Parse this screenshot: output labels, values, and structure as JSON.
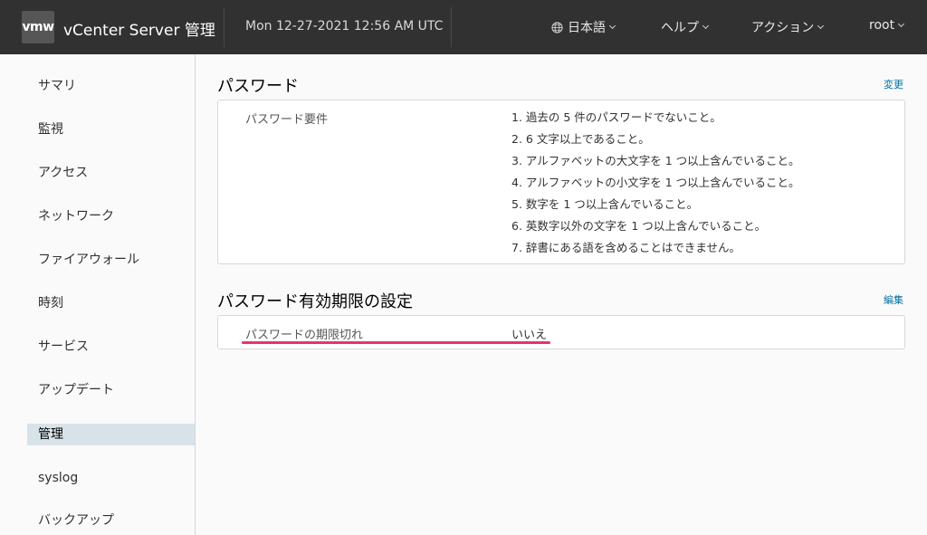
{
  "header": {
    "logo": "vmw",
    "title": "vCenter Server 管理",
    "datetime": "Mon 12-27-2021 12:56 AM UTC",
    "language": "日本語",
    "help": "ヘルプ",
    "actions": "アクション",
    "user": "root"
  },
  "sidebar": {
    "items": [
      {
        "label": "サマリ"
      },
      {
        "label": "監視"
      },
      {
        "label": "アクセス"
      },
      {
        "label": "ネットワーク"
      },
      {
        "label": "ファイアウォール"
      },
      {
        "label": "時刻"
      },
      {
        "label": "サービス"
      },
      {
        "label": "アップデート"
      },
      {
        "label": "管理"
      },
      {
        "label": "syslog"
      },
      {
        "label": "バックアップ"
      }
    ],
    "active": "管理"
  },
  "password": {
    "title": "パスワード",
    "action": "変更",
    "label": "パスワード要件",
    "requirements": [
      "1. 過去の 5 件のパスワードでないこと。",
      "2. 6 文字以上であること。",
      "3. アルファベットの大文字を 1 つ以上含んでいること。",
      "4. アルファベットの小文字を 1 つ以上含んでいること。",
      "5. 数字を 1 つ以上含んでいること。",
      "6. 英数字以外の文字を 1 つ以上含んでいること。",
      "7. 辞書にある語を含めることはできません。"
    ]
  },
  "expiration": {
    "title": "パスワード有効期限の設定",
    "action": "編集",
    "label": "パスワードの期限切れ",
    "value": "いいえ"
  },
  "colors": {
    "header_bg": "#313131",
    "link": "#0072a3",
    "active_nav": "#d8e3e9",
    "highlight": "#e8336d"
  }
}
